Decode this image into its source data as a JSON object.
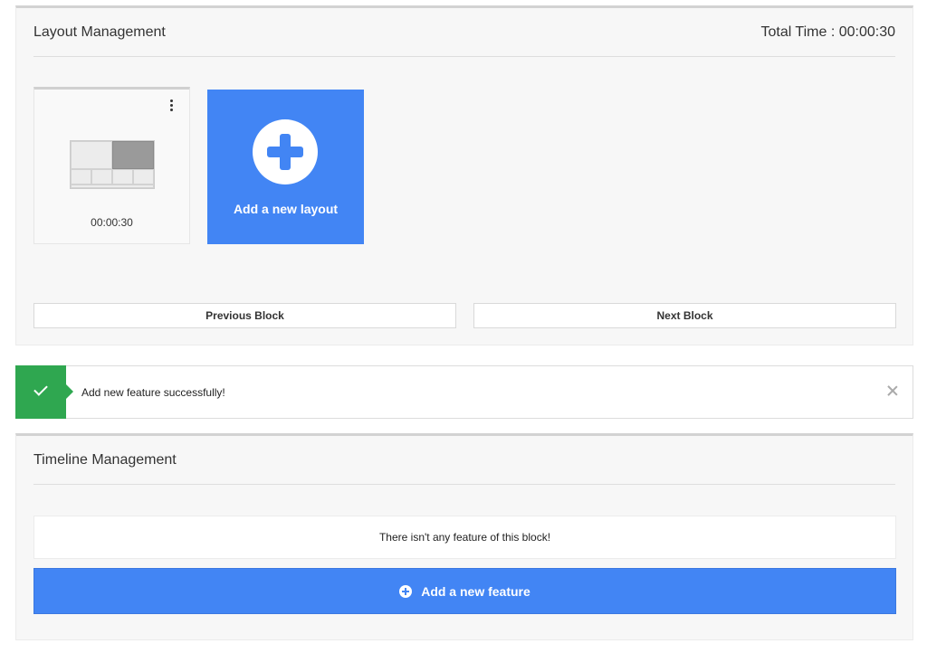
{
  "layout_management": {
    "title": "Layout Management",
    "total_time": "Total Time : 00:00:30",
    "layouts": [
      {
        "duration": "00:00:30"
      }
    ],
    "add_layout_label": "Add a new layout",
    "previous_label": "Previous Block",
    "next_label": "Next Block"
  },
  "notification": {
    "message": "Add new feature successfully!",
    "status": "success",
    "color": "#2fa750"
  },
  "timeline_management": {
    "title": "Timeline Management",
    "empty_message": "There isn't any feature of this block!",
    "add_feature_label": "Add a new feature"
  },
  "colors": {
    "accent": "#4285f4",
    "success": "#2fa750"
  }
}
